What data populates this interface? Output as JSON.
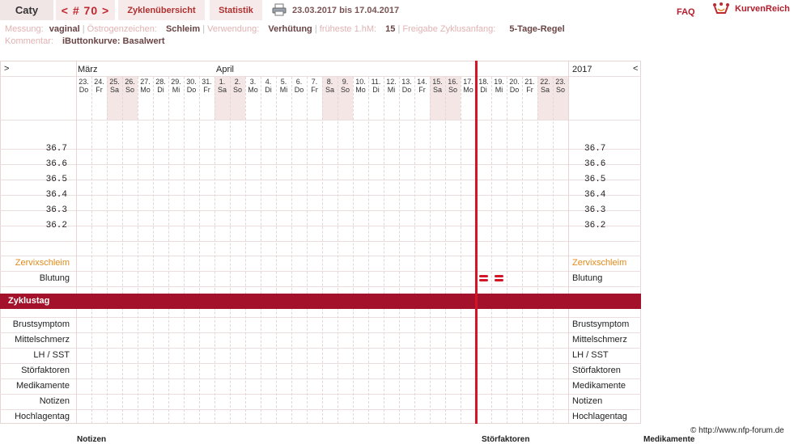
{
  "header": {
    "name": "Caty",
    "cycle_nav": "< # 70 >",
    "tab_cycles": "Zyklenübersicht",
    "tab_stats": "Statistik",
    "date_range": "23.03.2017 bis 17.04.2017",
    "faq": "FAQ",
    "logo": "KurvenReich"
  },
  "info": {
    "messung_label": "Messung:",
    "messung_value": "vaginal",
    "oestrogen_label": "Östrogenzeichen:",
    "oestrogen_value": "Schleim",
    "verwendung_label": "Verwendung:",
    "verwendung_value": "Verhütung",
    "hm_label": "früheste 1.hM:",
    "hm_value": "15",
    "freigabe_label": "Freigabe Zyklusanfang:",
    "freigabe_value": "5-Tage-Regel",
    "kommentar_label": "Kommentar:",
    "kommentar_value": "iButtonkurve: Basalwert"
  },
  "grid": {
    "nav_left": ">",
    "nav_right": "<",
    "year": "2017",
    "month_1": "März",
    "month_2": "April",
    "days": [
      {
        "d": "23.",
        "w": "Do",
        "we": false
      },
      {
        "d": "24.",
        "w": "Fr",
        "we": false
      },
      {
        "d": "25.",
        "w": "Sa",
        "we": true
      },
      {
        "d": "26.",
        "w": "So",
        "we": true
      },
      {
        "d": "27.",
        "w": "Mo",
        "we": false
      },
      {
        "d": "28.",
        "w": "Di",
        "we": false
      },
      {
        "d": "29.",
        "w": "Mi",
        "we": false
      },
      {
        "d": "30.",
        "w": "Do",
        "we": false
      },
      {
        "d": "31.",
        "w": "Fr",
        "we": false
      },
      {
        "d": "1.",
        "w": "Sa",
        "we": true
      },
      {
        "d": "2.",
        "w": "So",
        "we": true
      },
      {
        "d": "3.",
        "w": "Mo",
        "we": false
      },
      {
        "d": "4.",
        "w": "Di",
        "we": false
      },
      {
        "d": "5.",
        "w": "Mi",
        "we": false
      },
      {
        "d": "6.",
        "w": "Do",
        "we": false
      },
      {
        "d": "7.",
        "w": "Fr",
        "we": false
      },
      {
        "d": "8.",
        "w": "Sa",
        "we": true
      },
      {
        "d": "9.",
        "w": "So",
        "we": true
      },
      {
        "d": "10.",
        "w": "Mo",
        "we": false
      },
      {
        "d": "11.",
        "w": "Di",
        "we": false
      },
      {
        "d": "12.",
        "w": "Mi",
        "we": false
      },
      {
        "d": "13.",
        "w": "Do",
        "we": false
      },
      {
        "d": "14.",
        "w": "Fr",
        "we": false
      },
      {
        "d": "15.",
        "w": "Sa",
        "we": true
      },
      {
        "d": "16.",
        "w": "So",
        "we": true
      },
      {
        "d": "17.",
        "w": "Mo",
        "we": false
      },
      {
        "d": "18.",
        "w": "Di",
        "we": false
      },
      {
        "d": "19.",
        "w": "Mi",
        "we": false
      },
      {
        "d": "20.",
        "w": "Do",
        "we": false
      },
      {
        "d": "21.",
        "w": "Fr",
        "we": false
      },
      {
        "d": "22.",
        "w": "Sa",
        "we": true
      },
      {
        "d": "23.",
        "w": "So",
        "we": true
      }
    ],
    "temps": [
      "36.7",
      "36.6",
      "36.5",
      "36.4",
      "36.3",
      "36.2"
    ],
    "zervix_label": "Zervixschleim",
    "blutung_label": "Blutung",
    "zyklustag_label": "Zyklustag",
    "bleeding_days": [
      27,
      28
    ],
    "current_day": 26,
    "row_labels": [
      "Brustsymptom",
      "Mittelschmerz",
      "LH / SST",
      "Störfaktoren",
      "Medikamente",
      "Notizen",
      "Hochlagentag"
    ]
  },
  "footer": {
    "credit": "© http://www.nfp-forum.de",
    "col_notizen": "Notizen",
    "col_stoerfaktoren": "Störfaktoren",
    "col_medikamente": "Medikamente"
  },
  "colors": {
    "accent": "#a3122a",
    "marker": "#d3152a",
    "zervix": "#e08a1a"
  }
}
